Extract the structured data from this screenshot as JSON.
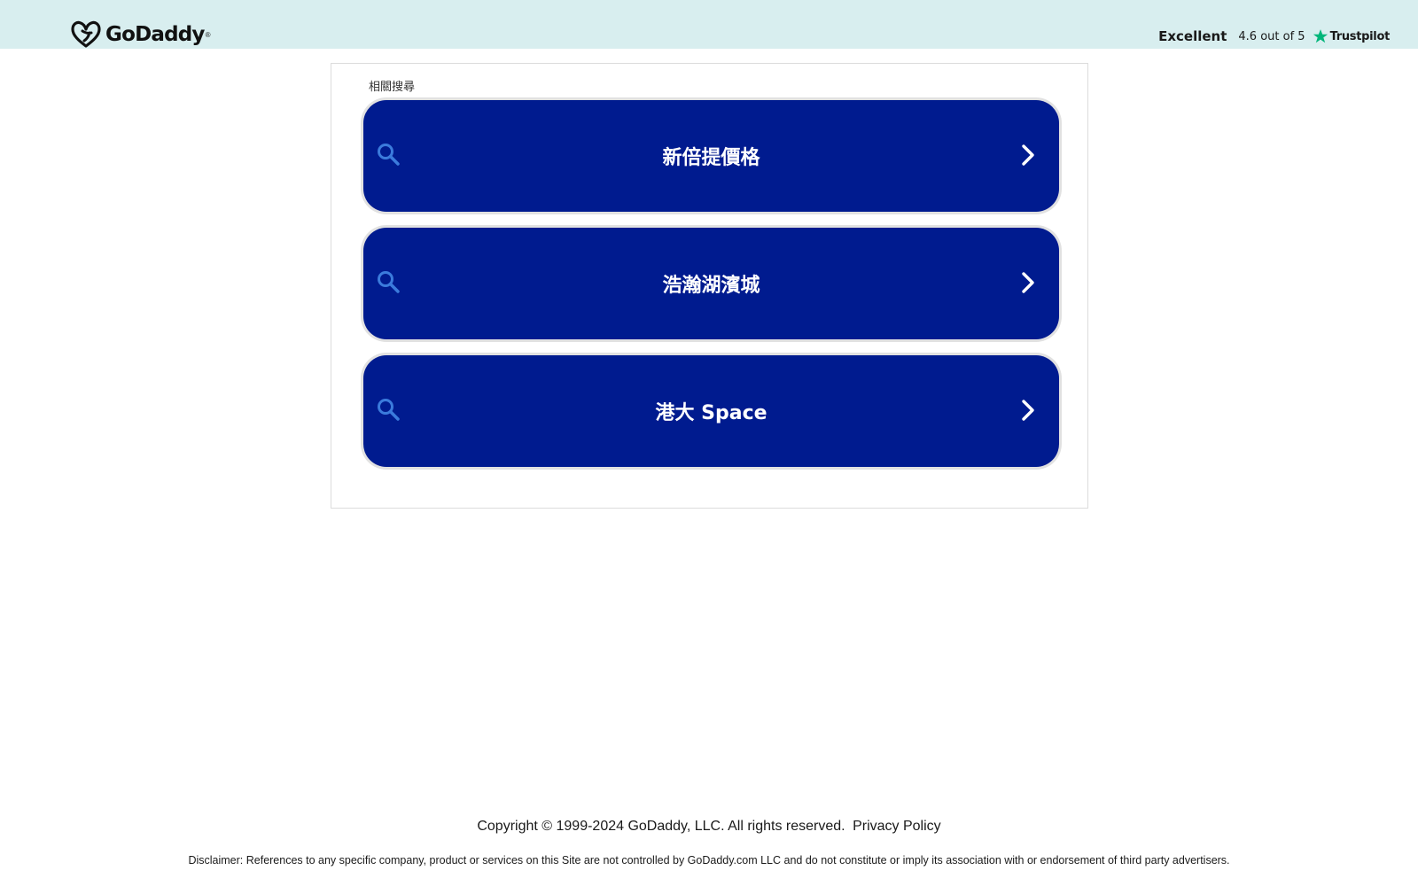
{
  "header": {
    "logo_text": "GoDaddy",
    "logo_mark": "®",
    "rating_word": "Excellent",
    "rating_score": "4.6 out of 5",
    "trustpilot_label": "Trustpilot"
  },
  "related": {
    "title": "相關搜尋",
    "items": [
      {
        "label": "新倍提價格"
      },
      {
        "label": "浩瀚湖濱城"
      },
      {
        "label": "港大 Space"
      }
    ]
  },
  "footer": {
    "copyright": "Copyright © 1999-2024 GoDaddy, LLC. All rights reserved.",
    "privacy": "Privacy Policy",
    "disclaimer": "Disclaimer: References to any specific company, product or services on this Site are not controlled by GoDaddy.com LLC and do not constitute or imply its association with or endorsement of third party advertisers."
  },
  "colors": {
    "topbar": "#d8eeef",
    "button_bg": "#001b8f",
    "search_icon": "#3b7bdc",
    "trustpilot_star": "#00b67a"
  },
  "icons": [
    "godaddy-logo-icon",
    "trustpilot-star-icon",
    "search-icon",
    "chevron-right-icon"
  ]
}
